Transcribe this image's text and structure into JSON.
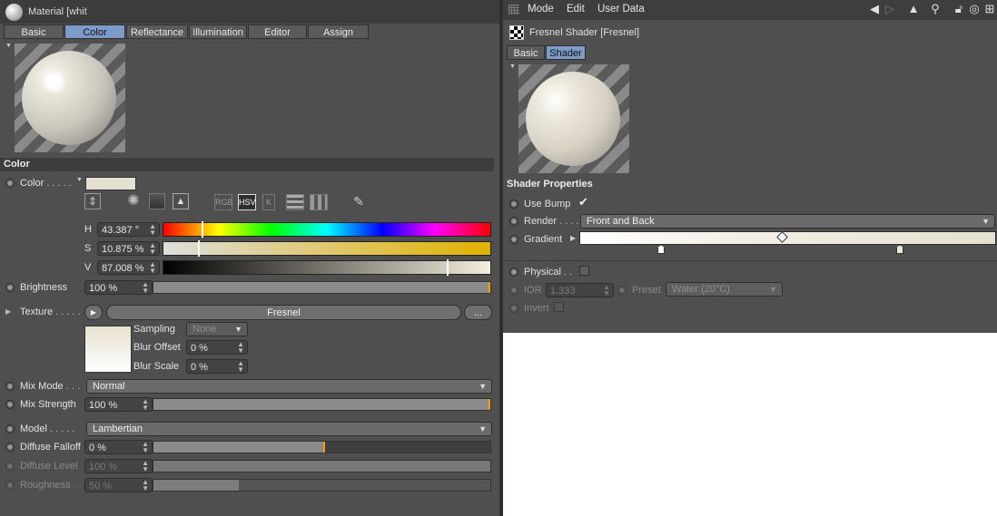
{
  "left": {
    "window_title": "Material [whit",
    "tabs": [
      "Basic",
      "Color",
      "Reflectance",
      "Illumination",
      "Editor",
      "Assign"
    ],
    "active_tab": "Color",
    "section_color": "Color",
    "color_label": "Color",
    "color_swatch": "#e4dfcf",
    "color_modes": [
      "RGB",
      "HSV",
      "K"
    ],
    "active_mode": "HSV",
    "hsv": {
      "h_label": "H",
      "h_value": "43.387 °",
      "s_label": "S",
      "s_value": "10.875 %",
      "v_label": "V",
      "v_value": "87.008 %"
    },
    "brightness_label": "Brightness",
    "brightness_value": "100 %",
    "brightness_fill": 1.0,
    "texture_label": "Texture",
    "texture_name": "Fresnel",
    "texture_more": "...",
    "sampling_label": "Sampling",
    "sampling_value": "None",
    "blur_offset_label": "Blur Offset",
    "blur_offset_value": "0 %",
    "blur_scale_label": "Blur Scale",
    "blur_scale_value": "0 %",
    "mix_mode_label": "Mix Mode",
    "mix_mode_value": "Normal",
    "mix_strength_label": "Mix Strength",
    "mix_strength_value": "100 %",
    "mix_strength_fill": 1.0,
    "model_label": "Model",
    "model_value": "Lambertian",
    "diffuse_falloff_label": "Diffuse Falloff",
    "diffuse_falloff_value": "0 %",
    "diffuse_level_label": "Diffuse Level",
    "diffuse_level_value": "100 %",
    "roughness_label": "Roughness",
    "roughness_value": "50 %"
  },
  "right": {
    "menu": [
      "Mode",
      "Edit",
      "User Data"
    ],
    "shader_title": "Fresnel Shader [Fresnel]",
    "tabs": [
      "Basic",
      "Shader"
    ],
    "active_tab": "Shader",
    "section": "Shader Properties",
    "use_bump_label": "Use Bump",
    "use_bump_checked": true,
    "render_label": "Render",
    "render_value": "Front and Back",
    "gradient_label": "Gradient",
    "physical_label": "Physical",
    "ior_label": "IOR",
    "ior_value": "1.333",
    "preset_label": "Preset",
    "preset_value": "Water (20°C)",
    "invert_label": "Invert"
  }
}
